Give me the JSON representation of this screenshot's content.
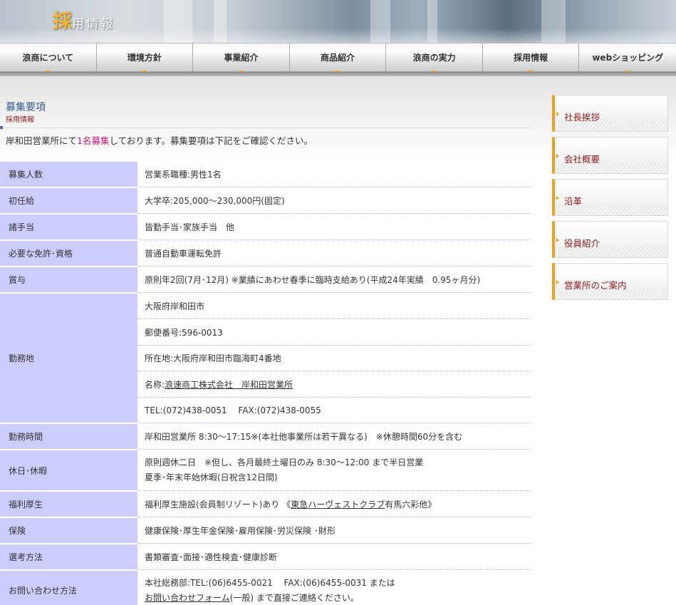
{
  "header": {
    "title_first_char": "採",
    "title_rest": "用情報"
  },
  "nav": {
    "items": [
      {
        "label": "浪商について"
      },
      {
        "label": "環境方針"
      },
      {
        "label": "事業紹介"
      },
      {
        "label": "商品紹介"
      },
      {
        "label": "浪商の実力"
      },
      {
        "label": "採用情報"
      },
      {
        "label": "webショッピング"
      }
    ]
  },
  "section": {
    "title": "募集要項",
    "subtitle": "採用情報",
    "intro_before": "岸和田営業所にて",
    "intro_highlight": "1名募集",
    "intro_after": "しております。募集要項は下記をご確認ください。"
  },
  "table": {
    "recruit_count": {
      "label": "募集人数",
      "value": "営業系職種:男性1名"
    },
    "salary": {
      "label": "初任給",
      "value": "大学卒:205,000～230,000円(固定)"
    },
    "allowance": {
      "label": "諸手当",
      "value": "皆勤手当･家族手当　他"
    },
    "license": {
      "label": "必要な免許･資格",
      "value": "普通自動車運転免許"
    },
    "bonus": {
      "label": "賞与",
      "value": "原則年2回(7月･12月) ※業績にあわせ春季に臨時支給あり(平成24年実績　0.95ヶ月分)"
    },
    "workplace": {
      "label": "勤務地",
      "city": "大阪府岸和田市",
      "postal": "郵便番号:596-0013",
      "address": "所在地:大阪府岸和田市臨海町4番地",
      "name_prefix": "名称:",
      "name_link": "浪速商工株式会社　岸和田営業所",
      "phone": "TEL:(072)438-0051　 FAX:(072)438-0055"
    },
    "hours": {
      "label": "勤務時間",
      "value": "岸和田営業所 8:30～17:15※(本社他事業所は若干異なる)　※休憩時間60分を含む"
    },
    "holidays": {
      "label": "休日･休暇",
      "line1": "原則週休二日　※但し、各月最終土曜日のみ 8:30～12:00 まで半日営業",
      "line2": "夏季･年末年始休暇(日祝含12日間)"
    },
    "welfare": {
      "label": "福利厚生",
      "before": "福利厚生施設(会員制リゾート)あり 《",
      "link": "東急ハーヴェストクラブ",
      "after": " 有馬六彩他》"
    },
    "insurance": {
      "label": "保険",
      "value": "健康保険･厚生年金保険･雇用保険･労災保険 ･財形"
    },
    "selection": {
      "label": "選考方法",
      "value": "書類審査･面接･適性検査･健康診断"
    },
    "contact": {
      "label": "お問い合わせ方法",
      "line1": "本社総務部:TEL:(06)6455-0021　 FAX:(06)6455-0031 または",
      "link": "お問い合わせフォーム",
      "after": "(一般) まで直接ご連絡ください。"
    }
  },
  "sidebar": {
    "items": [
      {
        "label": "社長挨拶"
      },
      {
        "label": "会社概要"
      },
      {
        "label": "沿革"
      },
      {
        "label": "役員紹介"
      },
      {
        "label": "営業所のご案内"
      }
    ]
  },
  "colors": {
    "label_bg": "#ccccff",
    "accent_orange": "#f0a020",
    "highlight_pink": "#c0187a",
    "title_blue": "#3b5a8c",
    "sidebar_text": "#8b1a1a"
  }
}
